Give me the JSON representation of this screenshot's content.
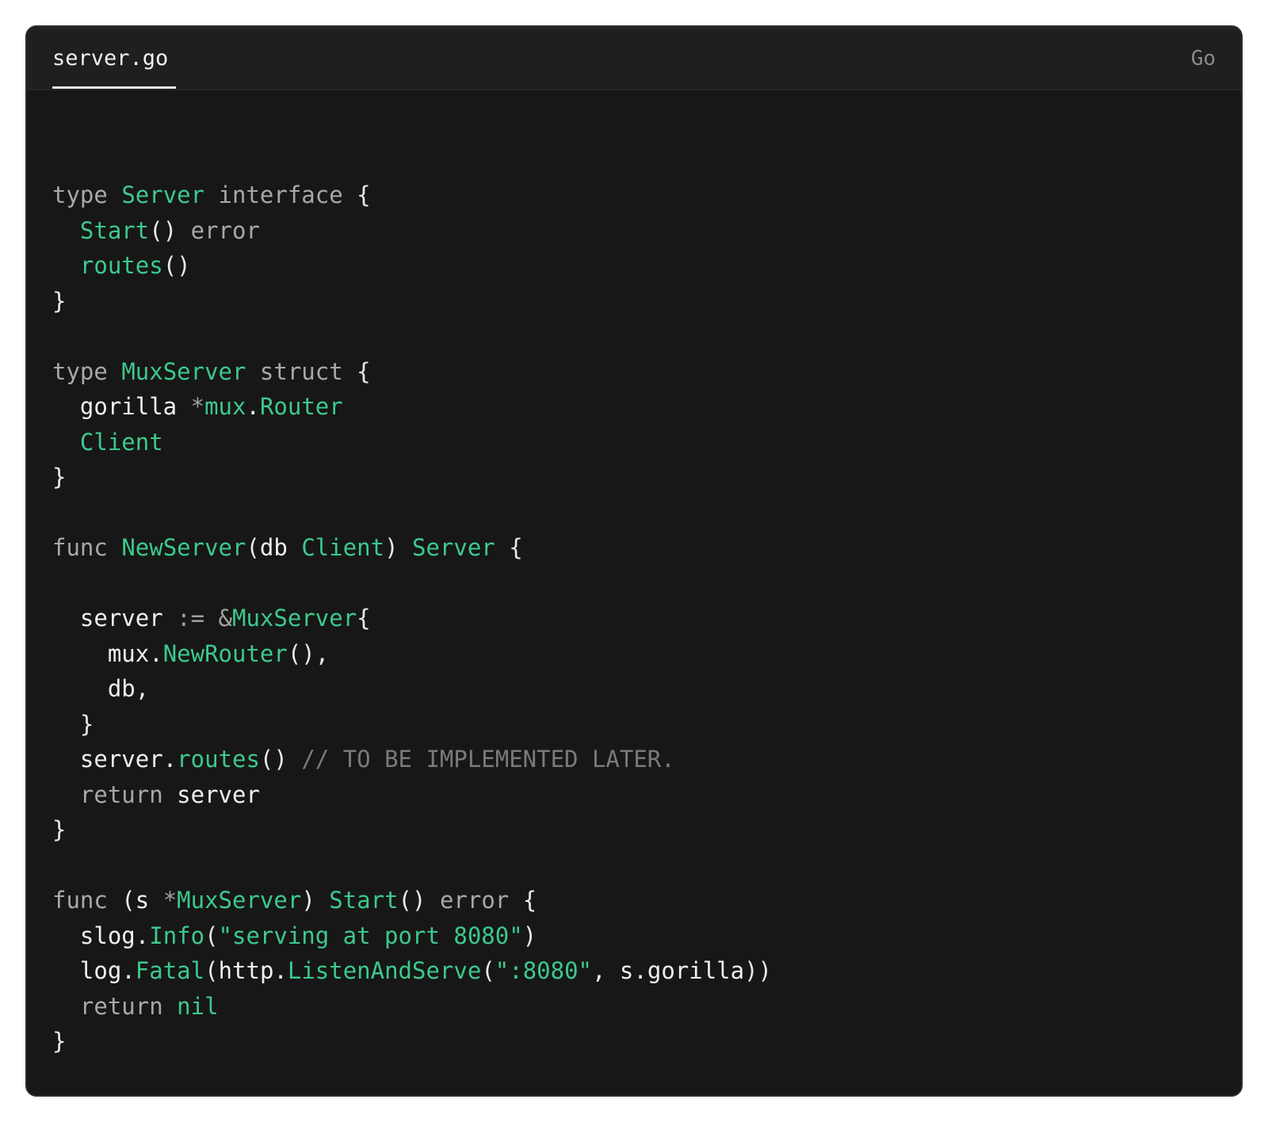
{
  "tab": {
    "filename": "server.go",
    "language": "Go"
  },
  "colors": {
    "background": "#171717",
    "tab_bar": "#1f1f1f",
    "keyword": "#a8a8a8",
    "identifier_green": "#3cc98d",
    "plain": "#f0f0f0",
    "comment": "#7a7a7a"
  },
  "code_lines": [
    [
      [
        "kw",
        "type"
      ],
      [
        "pn",
        " "
      ],
      [
        "fn",
        "Server"
      ],
      [
        "pn",
        " "
      ],
      [
        "kw",
        "interface"
      ],
      [
        "pn",
        " {"
      ]
    ],
    [
      [
        "pn",
        "  "
      ],
      [
        "fn",
        "Start"
      ],
      [
        "pn",
        "() "
      ],
      [
        "kw",
        "error"
      ]
    ],
    [
      [
        "pn",
        "  "
      ],
      [
        "fn",
        "routes"
      ],
      [
        "pn",
        "()"
      ]
    ],
    [
      [
        "pn",
        "}"
      ]
    ],
    [],
    [
      [
        "kw",
        "type"
      ],
      [
        "pn",
        " "
      ],
      [
        "fn",
        "MuxServer"
      ],
      [
        "pn",
        " "
      ],
      [
        "kw",
        "struct"
      ],
      [
        "pn",
        " {"
      ]
    ],
    [
      [
        "pn",
        "  "
      ],
      [
        "id",
        "gorilla"
      ],
      [
        "pn",
        " "
      ],
      [
        "op",
        "*"
      ],
      [
        "fn",
        "mux"
      ],
      [
        "pn",
        "."
      ],
      [
        "fn",
        "Router"
      ]
    ],
    [
      [
        "pn",
        "  "
      ],
      [
        "fn",
        "Client"
      ]
    ],
    [
      [
        "pn",
        "}"
      ]
    ],
    [],
    [
      [
        "kw",
        "func"
      ],
      [
        "pn",
        " "
      ],
      [
        "fn",
        "NewServer"
      ],
      [
        "pn",
        "("
      ],
      [
        "id",
        "db"
      ],
      [
        "pn",
        " "
      ],
      [
        "fn",
        "Client"
      ],
      [
        "pn",
        ") "
      ],
      [
        "fn",
        "Server"
      ],
      [
        "pn",
        " {"
      ]
    ],
    [],
    [
      [
        "pn",
        "  "
      ],
      [
        "id",
        "server"
      ],
      [
        "pn",
        " "
      ],
      [
        "op",
        ":="
      ],
      [
        "pn",
        " "
      ],
      [
        "op",
        "&"
      ],
      [
        "fn",
        "MuxServer"
      ],
      [
        "pn",
        "{"
      ]
    ],
    [
      [
        "pn",
        "    "
      ],
      [
        "id",
        "mux"
      ],
      [
        "pn",
        "."
      ],
      [
        "fn",
        "NewRouter"
      ],
      [
        "pn",
        "(),"
      ]
    ],
    [
      [
        "pn",
        "    "
      ],
      [
        "id",
        "db"
      ],
      [
        "pn",
        ","
      ]
    ],
    [
      [
        "pn",
        "  }"
      ]
    ],
    [
      [
        "pn",
        "  "
      ],
      [
        "id",
        "server"
      ],
      [
        "pn",
        "."
      ],
      [
        "fn",
        "routes"
      ],
      [
        "pn",
        "() "
      ],
      [
        "cm",
        "// TO BE IMPLEMENTED LATER."
      ]
    ],
    [
      [
        "pn",
        "  "
      ],
      [
        "kw",
        "return"
      ],
      [
        "pn",
        " "
      ],
      [
        "id",
        "server"
      ]
    ],
    [
      [
        "pn",
        "}"
      ]
    ],
    [],
    [
      [
        "kw",
        "func"
      ],
      [
        "pn",
        " ("
      ],
      [
        "id",
        "s"
      ],
      [
        "pn",
        " "
      ],
      [
        "op",
        "*"
      ],
      [
        "fn",
        "MuxServer"
      ],
      [
        "pn",
        ") "
      ],
      [
        "fn",
        "Start"
      ],
      [
        "pn",
        "() "
      ],
      [
        "kw",
        "error"
      ],
      [
        "pn",
        " {"
      ]
    ],
    [
      [
        "pn",
        "  "
      ],
      [
        "id",
        "slog"
      ],
      [
        "pn",
        "."
      ],
      [
        "fn",
        "Info"
      ],
      [
        "pn",
        "("
      ],
      [
        "str",
        "\"serving at port 8080\""
      ],
      [
        "pn",
        ")"
      ]
    ],
    [
      [
        "pn",
        "  "
      ],
      [
        "id",
        "log"
      ],
      [
        "pn",
        "."
      ],
      [
        "fn",
        "Fatal"
      ],
      [
        "pn",
        "("
      ],
      [
        "id",
        "http"
      ],
      [
        "pn",
        "."
      ],
      [
        "fn",
        "ListenAndServe"
      ],
      [
        "pn",
        "("
      ],
      [
        "str",
        "\":8080\""
      ],
      [
        "pn",
        ", "
      ],
      [
        "id",
        "s"
      ],
      [
        "pn",
        "."
      ],
      [
        "id",
        "gorilla"
      ],
      [
        "pn",
        "))"
      ]
    ],
    [
      [
        "pn",
        "  "
      ],
      [
        "kw",
        "return"
      ],
      [
        "pn",
        " "
      ],
      [
        "fn",
        "nil"
      ]
    ],
    [
      [
        "pn",
        "}"
      ]
    ]
  ]
}
